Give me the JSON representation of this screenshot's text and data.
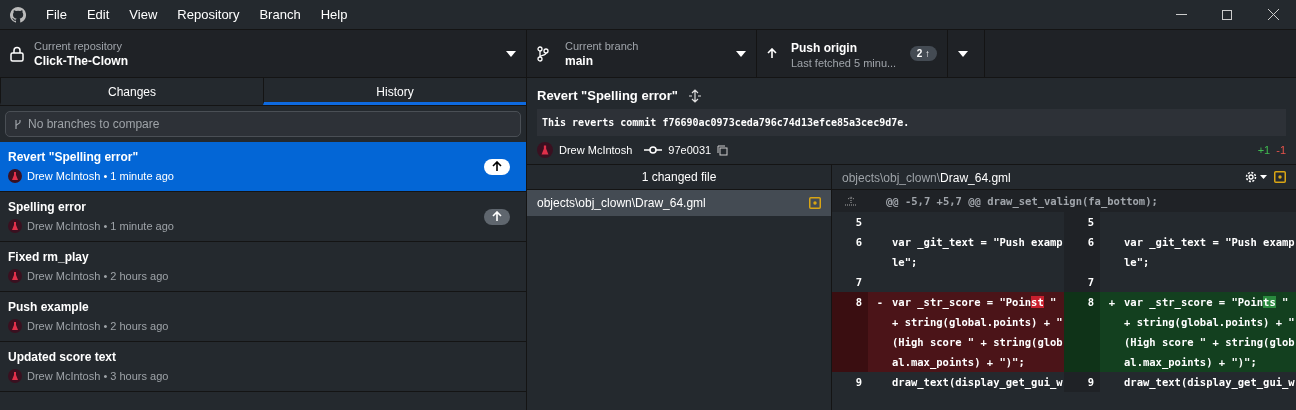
{
  "menu": [
    "File",
    "Edit",
    "View",
    "Repository",
    "Branch",
    "Help"
  ],
  "toolbar": {
    "repository": {
      "caption": "Current repository",
      "name": "Click-The-Clown"
    },
    "branch": {
      "caption": "Current branch",
      "name": "main"
    },
    "push": {
      "title": "Push origin",
      "subtitle": "Last fetched 5 minu...",
      "count": "2 ↑"
    }
  },
  "tabs": [
    {
      "label": "Changes",
      "selected": false
    },
    {
      "label": "History",
      "selected": true
    }
  ],
  "compare": {
    "placeholder": "No branches to compare"
  },
  "commits": [
    {
      "title": "Revert \"Spelling error\"",
      "meta": "Drew McIntosh • 1 minute ago",
      "unpushed": true,
      "selected": true
    },
    {
      "title": "Spelling error",
      "meta": "Drew McIntosh • 1 minute ago",
      "unpushed": true,
      "selected": false
    },
    {
      "title": "Fixed rm_play",
      "meta": "Drew McIntosh • 2 hours ago",
      "unpushed": false,
      "selected": false
    },
    {
      "title": "Push example",
      "meta": "Drew McIntosh • 2 hours ago",
      "unpushed": false,
      "selected": false
    },
    {
      "title": "Updated score text",
      "meta": "Drew McIntosh • 3 hours ago",
      "unpushed": false,
      "selected": false
    }
  ],
  "commit": {
    "title": "Revert \"Spelling error\"",
    "message": "This reverts commit f76690ac0973ceda796c74d13efce85a3cec9d7e.",
    "author": "Drew McIntosh",
    "sha": "97e0031",
    "added": "+1",
    "removed": "-1"
  },
  "files": {
    "header": "1 changed file",
    "items": [
      {
        "path": "objects\\obj_clown\\Draw_64.gml",
        "selected": true
      }
    ]
  },
  "diff": {
    "dir": "objects\\obj_clown\\",
    "file": "Draw_64.gml",
    "hunk": "@@ -5,7 +5,7 @@ draw_set_valign(fa_bottom);",
    "lines": [
      {
        "kind": "context",
        "old": "5",
        "new": "5"
      },
      {
        "kind": "context",
        "old": "6",
        "new": "6",
        "old_text": "var _git_text = \"Push example\";",
        "new_text": "var _git_text = \"Push example\";"
      },
      {
        "kind": "context",
        "old": "7",
        "new": "7"
      },
      {
        "kind": "change",
        "old": "8",
        "new": "8",
        "del_mark": "-",
        "add_mark": "+",
        "del": [
          "var _str_score = \"Poin",
          "st",
          " \" + string(global.points) + \" (High score \" + string(global.max_points) + \")\";"
        ],
        "add": [
          "var _str_score = \"Poin",
          "ts",
          " \" + string(global.points) + \" (High score \" + string(global.max_points) + \")\";"
        ]
      },
      {
        "kind": "context",
        "old": "9",
        "new": "9",
        "old_text": "draw_text(display_get_gui_w",
        "new_text": "draw_text(display_get_gui_w"
      }
    ]
  }
}
